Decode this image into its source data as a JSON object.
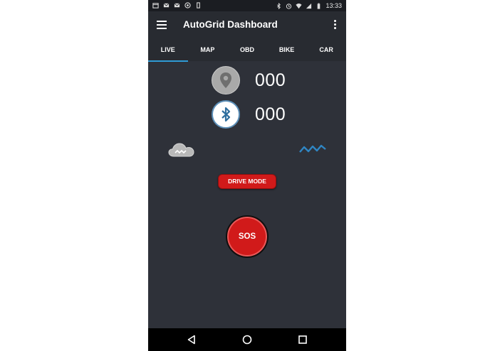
{
  "status_bar": {
    "time": "13:33",
    "left_icons": [
      "calendar-icon",
      "mail-icon",
      "mail-icon",
      "whatsapp-icon",
      "phone-icon"
    ],
    "right_icons": [
      "bluetooth-icon",
      "alarm-icon",
      "wifi-icon",
      "signal-icon",
      "battery-icon"
    ]
  },
  "app_bar": {
    "title": "AutoGrid Dashboard",
    "menu_icon": "menu-icon",
    "overflow_icon": "more-vert-icon"
  },
  "tabs": [
    {
      "label": "LIVE",
      "active": true
    },
    {
      "label": "MAP",
      "active": false
    },
    {
      "label": "OBD",
      "active": false
    },
    {
      "label": "BIKE",
      "active": false
    },
    {
      "label": "CAR",
      "active": false
    }
  ],
  "live": {
    "location_count": "000",
    "bluetooth_count": "000",
    "drive_mode_label": "DRIVE MODE",
    "sos_label": "SOS"
  },
  "colors": {
    "background": "#2e3139",
    "appbar": "#282b31",
    "accent": "#2f9bd6",
    "danger": "#d11a1a"
  },
  "nav_bar": {
    "icons": [
      "back-icon",
      "home-icon",
      "recent-apps-icon"
    ]
  }
}
